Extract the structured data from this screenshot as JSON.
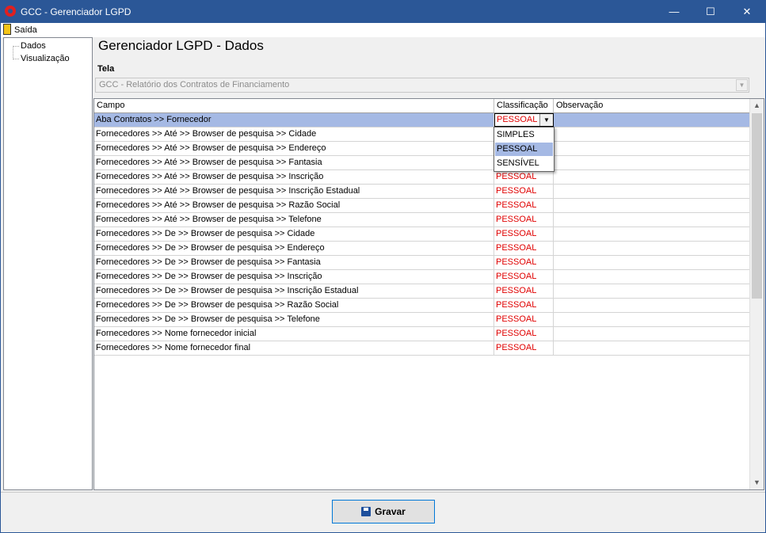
{
  "window": {
    "title": "GCC - Gerenciador LGPD",
    "controls": {
      "minimize": "—",
      "maximize": "☐",
      "close": "✕"
    }
  },
  "menu": {
    "exit_label": "Saída"
  },
  "sidebar": {
    "items": [
      {
        "label": "Dados"
      },
      {
        "label": "Visualização"
      }
    ]
  },
  "main": {
    "title": "Gerenciador LGPD - Dados",
    "tela_label": "Tela",
    "tela_value": "GCC - Relatório dos Contratos de Financiamento"
  },
  "grid": {
    "columns": [
      "Campo",
      "Classificação",
      "Observação"
    ],
    "rows": [
      {
        "campo": "Aba Contratos >> Fornecedor",
        "classificacao": "PESSOAL",
        "observacao": ""
      },
      {
        "campo": "Fornecedores >> Até >> Browser de pesquisa >> Cidade",
        "classificacao": "",
        "observacao": ""
      },
      {
        "campo": "Fornecedores >> Até >> Browser de pesquisa >> Endereço",
        "classificacao": "",
        "observacao": ""
      },
      {
        "campo": "Fornecedores >> Até >> Browser de pesquisa >> Fantasia",
        "classificacao": "",
        "observacao": ""
      },
      {
        "campo": "Fornecedores >> Até >> Browser de pesquisa >> Inscrição",
        "classificacao": "PESSOAL",
        "observacao": ""
      },
      {
        "campo": "Fornecedores >> Até >> Browser de pesquisa >> Inscrição Estadual",
        "classificacao": "PESSOAL",
        "observacao": ""
      },
      {
        "campo": "Fornecedores >> Até >> Browser de pesquisa >> Razão Social",
        "classificacao": "PESSOAL",
        "observacao": ""
      },
      {
        "campo": "Fornecedores >> Até >> Browser de pesquisa >> Telefone",
        "classificacao": "PESSOAL",
        "observacao": ""
      },
      {
        "campo": "Fornecedores >> De >> Browser de pesquisa >> Cidade",
        "classificacao": "PESSOAL",
        "observacao": ""
      },
      {
        "campo": "Fornecedores >> De >> Browser de pesquisa >> Endereço",
        "classificacao": "PESSOAL",
        "observacao": ""
      },
      {
        "campo": "Fornecedores >> De >> Browser de pesquisa >> Fantasia",
        "classificacao": "PESSOAL",
        "observacao": ""
      },
      {
        "campo": "Fornecedores >> De >> Browser de pesquisa >> Inscrição",
        "classificacao": "PESSOAL",
        "observacao": ""
      },
      {
        "campo": "Fornecedores >> De >> Browser de pesquisa >> Inscrição Estadual",
        "classificacao": "PESSOAL",
        "observacao": ""
      },
      {
        "campo": "Fornecedores >> De >> Browser de pesquisa >> Razão Social",
        "classificacao": "PESSOAL",
        "observacao": ""
      },
      {
        "campo": "Fornecedores >> De >> Browser de pesquisa >> Telefone",
        "classificacao": "PESSOAL",
        "observacao": ""
      },
      {
        "campo": "Fornecedores >> Nome fornecedor inicial",
        "classificacao": "PESSOAL",
        "observacao": ""
      },
      {
        "campo": "Fornecedores >> Nome fornecedor final",
        "classificacao": "PESSOAL",
        "observacao": ""
      }
    ],
    "dropdown_options": [
      "SIMPLES",
      "PESSOAL",
      "SENSÍVEL"
    ],
    "dropdown_selected": "PESSOAL"
  },
  "footer": {
    "save_label": "Gravar"
  },
  "colors": {
    "titlebar": "#2b5797",
    "selection": "#a5b9e4",
    "classification_text": "#e00000"
  },
  "icons": {
    "app": "gcc-logo-icon",
    "exit": "exit-door-icon",
    "save": "floppy-disk-icon"
  }
}
